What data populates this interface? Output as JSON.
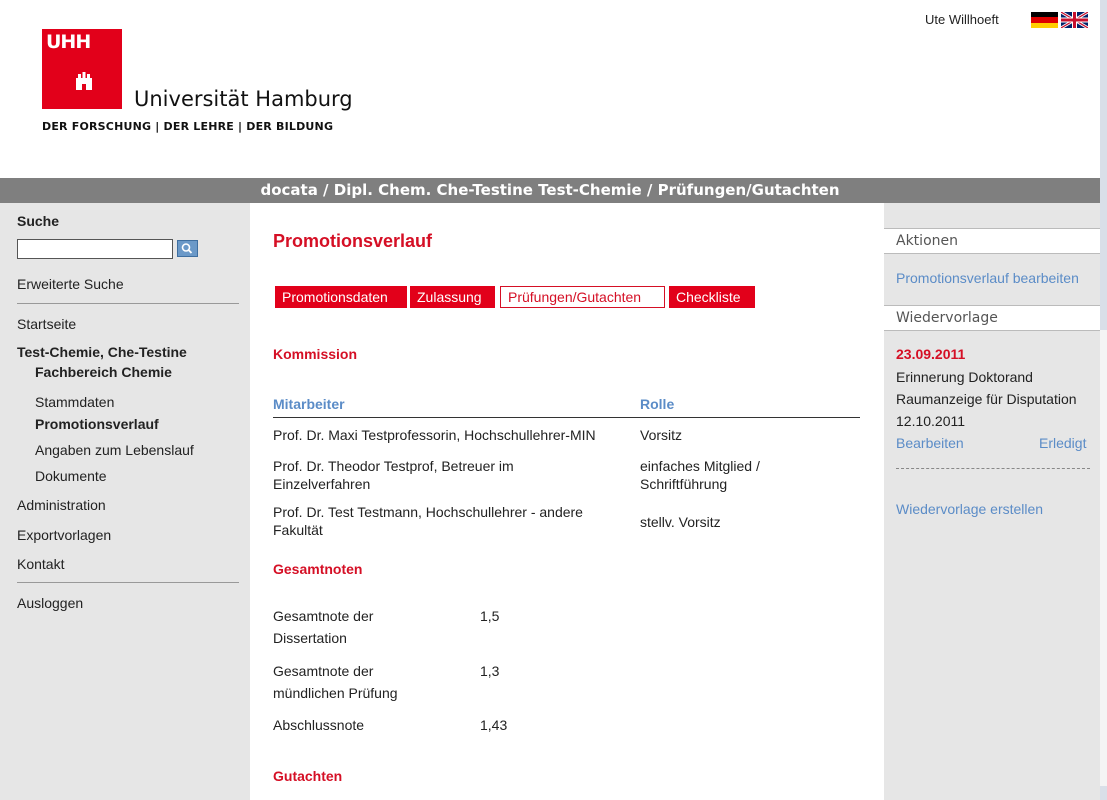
{
  "header": {
    "logo_mark": "UHH",
    "university_name": "Universität Hamburg",
    "tagline": "DER FORSCHUNG | DER LEHRE | DER BILDUNG",
    "user_name": "Ute Willhoeft"
  },
  "breadcrumb": "docata / Dipl. Chem. Che-Testine Test-Chemie / Prüfungen/Gutachten",
  "sidebar": {
    "search_label": "Suche",
    "search_value": "",
    "advanced_search": "Erweiterte Suche",
    "start": "Startseite",
    "person_name": "Test-Chemie, Che-Testine",
    "department": "Fachbereich Chemie",
    "sub_items": [
      "Stammdaten",
      "Promotionsverlauf",
      "Angaben zum Lebenslauf",
      "Dokumente"
    ],
    "administration": "Administration",
    "export_templates": "Exportvorlagen",
    "contact": "Kontakt",
    "logout": "Ausloggen"
  },
  "main": {
    "title": "Promotionsverlauf",
    "tabs": [
      "Promotionsdaten",
      "Zulassung",
      "Prüfungen/Gutachten",
      "Checkliste"
    ],
    "active_tab": "Prüfungen/Gutachten",
    "commission": {
      "title": "Kommission",
      "headers": [
        "Mitarbeiter",
        "Rolle"
      ],
      "rows": [
        {
          "member": "Prof. Dr. Maxi Testprofessorin, Hochschullehrer-MIN",
          "role": "Vorsitz"
        },
        {
          "member": "Prof. Dr. Theodor Testprof, Betreuer im Einzelverfahren",
          "role": "einfaches Mitglied / Schriftführung"
        },
        {
          "member": "Prof. Dr. Test Testmann, Hochschullehrer - andere Fakultät",
          "role": "stellv. Vorsitz"
        }
      ]
    },
    "grades": {
      "title": "Gesamtnoten",
      "rows": [
        {
          "label": "Gesamtnote der Dissertation",
          "value": "1,5"
        },
        {
          "label": "Gesamtnote der mündlichen Prüfung",
          "value": "1,3"
        },
        {
          "label": "Abschlussnote",
          "value": "1,43"
        }
      ]
    },
    "reports_title": "Gutachten"
  },
  "right": {
    "actions_title": "Aktionen",
    "edit_link": "Promotionsverlauf bearbeiten",
    "followup_title": "Wiedervorlage",
    "followup": {
      "date": "23.09.2011",
      "line1": "Erinnerung Doktorand",
      "line2": "Raumanzeige für Disputation",
      "line3": "12.10.2011",
      "edit": "Bearbeiten",
      "done": "Erledigt"
    },
    "create_link": "Wiedervorlage erstellen"
  },
  "colors": {
    "uhh_red": "#e2001a",
    "link_blue": "#5b8cc7",
    "breadcrumb_gray": "#7f7f7f",
    "panel_gray": "#e6e6e6"
  }
}
